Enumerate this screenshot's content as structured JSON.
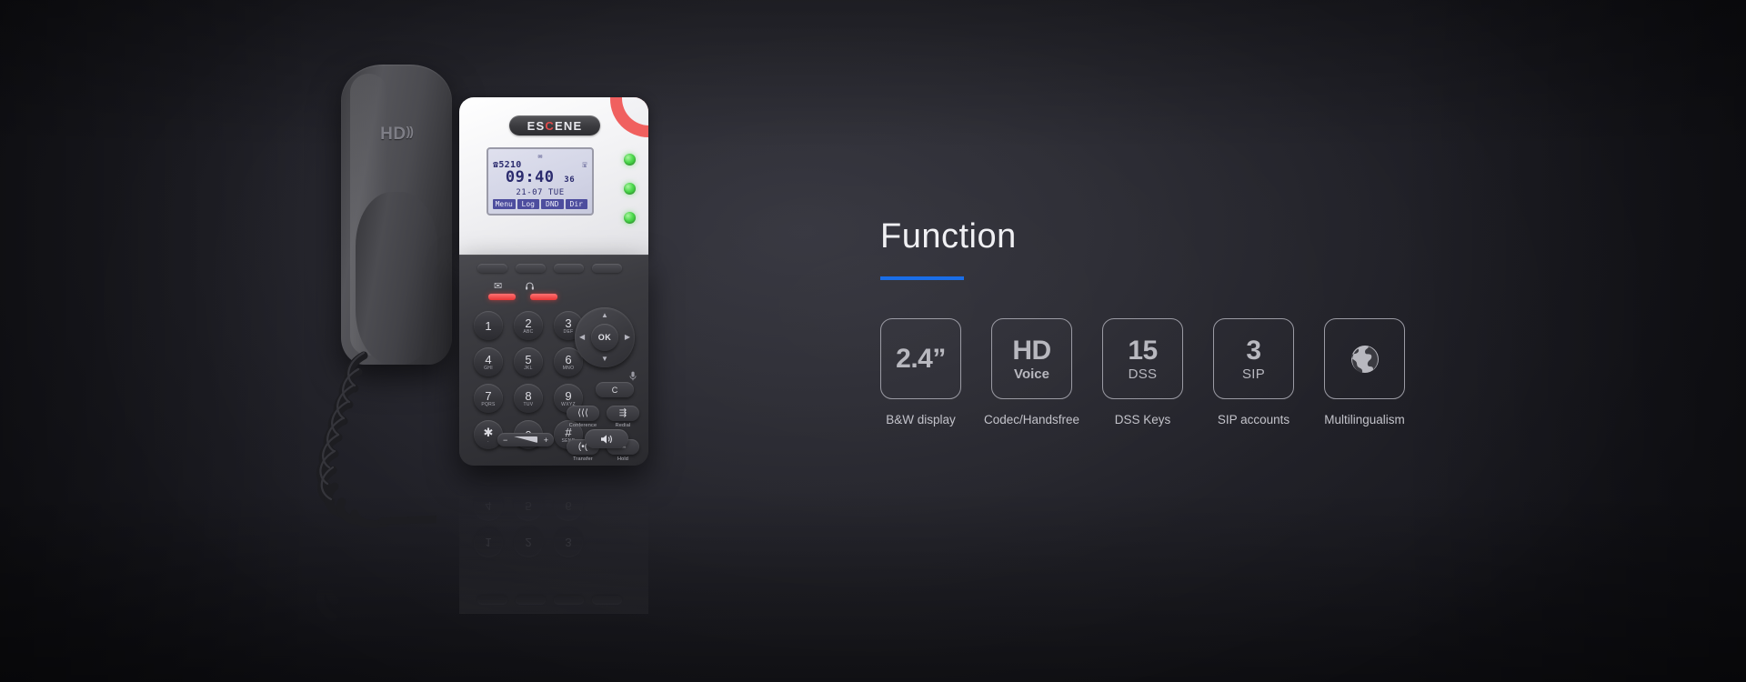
{
  "background": {
    "base_color": "#17171d",
    "highlight_color": "#33333c"
  },
  "product": {
    "brand": "ESCENE",
    "brand_accent_letter": "C",
    "handset": {
      "logo_text": "HD",
      "logo_waves": "))",
      "label": "handset"
    },
    "accent_colors": {
      "red_corner": "#f0605f",
      "led_green": "#4cd94c",
      "led_red_bar": "#e83636"
    },
    "lcd": {
      "envelope_icon": "✉",
      "phone_icon": "☎",
      "extension": "5210",
      "handset_icon": "☏",
      "time": "09:40",
      "seconds": "36",
      "date": "21-07  TUE",
      "softkeys": [
        "Menu",
        "Log",
        "DND",
        "Dir"
      ]
    },
    "feature_icons": [
      {
        "name": "voicemail-icon",
        "glyph": "✉"
      },
      {
        "name": "headset-icon",
        "glyph": "⌾"
      }
    ],
    "keypad": [
      {
        "num": "1",
        "sub": ""
      },
      {
        "num": "2",
        "sub": "ABC"
      },
      {
        "num": "3",
        "sub": "DEF"
      },
      {
        "num": "4",
        "sub": "GHI"
      },
      {
        "num": "5",
        "sub": "JKL"
      },
      {
        "num": "6",
        "sub": "MNO"
      },
      {
        "num": "7",
        "sub": "PQRS"
      },
      {
        "num": "8",
        "sub": "TUV"
      },
      {
        "num": "9",
        "sub": "WXYZ"
      },
      {
        "num": "✱",
        "sub": "."
      },
      {
        "num": "0",
        "sub": ""
      },
      {
        "num": "#",
        "sub": "SEND"
      }
    ],
    "navpad": {
      "ok_label": "OK",
      "up": "▲",
      "down": "▼",
      "left": "◀",
      "right": "▶"
    },
    "clear_button": "C",
    "function_keys": [
      {
        "label": "Conference",
        "glyph": "⟨⟨⟨"
      },
      {
        "label": "Redial",
        "glyph": "⇶"
      },
      {
        "label": "Transfer",
        "glyph": "(•("
      },
      {
        "label": "Hold",
        "glyph": "≃"
      }
    ],
    "volume": {
      "minus": "−",
      "plus": "+"
    },
    "speaker_glyph": "🔊"
  },
  "panel": {
    "title": "Function",
    "rule_color": "#1a6ee8",
    "cards": [
      {
        "big": "2.4”",
        "small": "",
        "icon": "",
        "label": "B&W display"
      },
      {
        "big": "HD",
        "small": "Voice",
        "icon": "",
        "label": "Codec/Handsfree"
      },
      {
        "big": "15",
        "small": "DSS",
        "icon": "",
        "label": "DSS Keys"
      },
      {
        "big": "3",
        "small": "SIP",
        "icon": "",
        "label": "SIP accounts"
      },
      {
        "big": "",
        "small": "",
        "icon": "globe-icon",
        "label": "Multilingualism"
      }
    ]
  }
}
